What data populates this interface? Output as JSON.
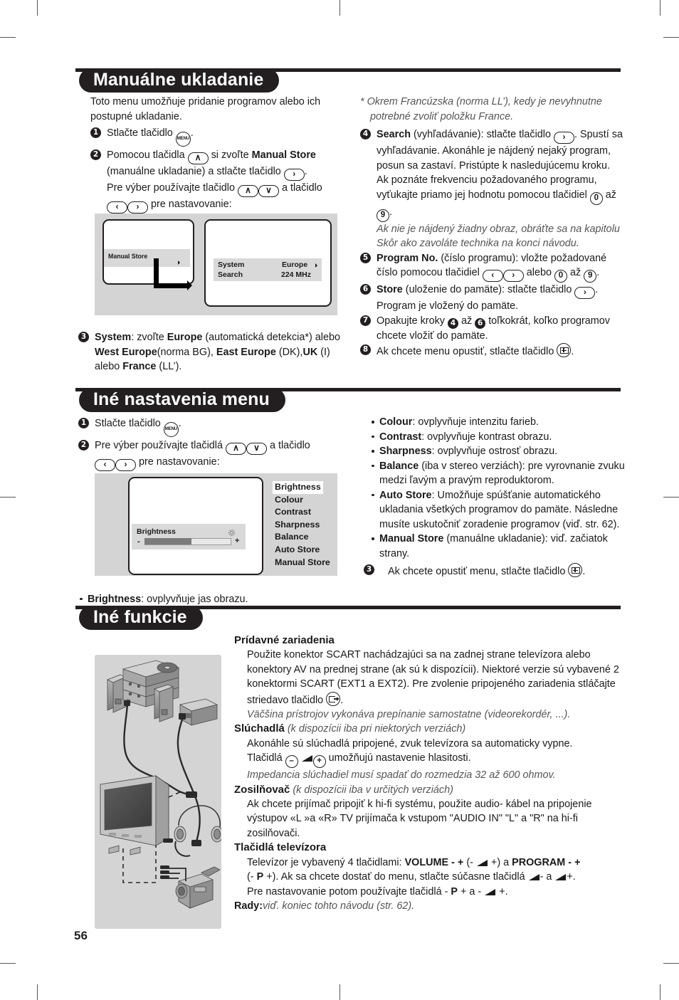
{
  "page": {
    "number": "56"
  },
  "sections": {
    "manual_store": {
      "title": "Manuálne ukladanie",
      "intro": "Toto menu umožňuje pridanie programov alebo ich postupné ukladanie.",
      "step1_pre": "Stlačte tlačidlo",
      "step1_post": ".",
      "step2_a": "Pomocou tlačidla",
      "step2_b": "si zvoľte",
      "step2_bold": "Manual Store",
      "step2_c": "(manuálne ukladanie) a stlačte tlačidlo",
      "step2_d": ".",
      "step2_e": "Pre výber používajte tlačidlo",
      "step2_f": "a tlačidlo",
      "step2_g": "pre nastavovanie:",
      "step3_bold1": "System",
      "step3_a": ": zvoľte",
      "step3_bold2": "Europe",
      "step3_b": "(automatická detekcia*) alebo",
      "step3_bold3": "West Europe",
      "step3_c": "(norma BG),",
      "step3_bold4": "East Europe",
      "step3_d": "(DK),",
      "step3_bold5": "UK",
      "step3_e": "(I) alebo",
      "step3_bold6": "France",
      "step3_f": "(LL’).",
      "footnote": "* Okrem Francúzska (norma LL’), kedy je nevyhnutne potrebné zvoliť položku France.",
      "step4_bold": "Search",
      "step4_a": "(vyhľadávanie): stlačte tlačidlo",
      "step4_b": ". Spustí sa vyhľadávanie. Akonáhle je nájdený nejaký program, posun sa zastaví. Pristúpte k nasledujúcemu kroku. Ak poznáte frekvenciu požadovaného programu, vyťukajte priamo jej hodnotu pomocou tlačidiel",
      "step4_c": "až",
      "step4_d": ".",
      "step4_note": "Ak nie je nájdený žiadny obraz, obráťte sa na kapitolu Skôr ako zavoláte technika na konci návodu.",
      "step5_bold": "Program No.",
      "step5_a": "(číslo programu): vložte požadované číslo pomocou tlačidiel",
      "step5_b": "alebo",
      "step5_c": "až",
      "step5_d": ".",
      "step6_bold": "Store",
      "step6_a": "(uloženie do pamäte): stlačte tlačidlo",
      "step6_b": ". Program je vložený do pamäte.",
      "step7_a": "Opakujte kroky",
      "step7_b": "až",
      "step7_c": "toľkokrát, koľko programov chcete vložiť do pamäte.",
      "step8_a": "Ak chcete menu opustiť, stlačte tlačidlo",
      "step8_b": ".",
      "osd": {
        "left_item": "Manual Store",
        "row1_label": "System",
        "row1_value": "Europe",
        "row2_label": "Search",
        "row2_value": "224 MHz"
      },
      "keys": {
        "menu": "MENU",
        "up": "∧",
        "down": "∨",
        "left": "‹",
        "right": "›",
        "zero": "0",
        "nine": "9",
        "num4": "4",
        "num6": "6"
      }
    },
    "other_settings": {
      "title": "Iné nastavenia menu",
      "step1_pre": "Stlačte tlačidlo",
      "step1_post": ".",
      "step2_a": "Pre výber používajte tlačidlá",
      "step2_b": "a tlačidlo",
      "step2_c": "pre nastavovanie:",
      "brightness_caption_bold": "Brightness",
      "brightness_caption_rest": ": ovplyvňuje jas obrazu.",
      "osd": {
        "slider_label": "Brightness",
        "minus": "-",
        "plus": "+",
        "menu_items": [
          "Brightness",
          "Colour",
          "Contrast",
          "Sharpness",
          "Balance",
          "Auto Store",
          "Manual Store"
        ],
        "selected_index": 0,
        "slider_percent": 54
      },
      "bullets": [
        {
          "bold": "Colour",
          "rest": ": ovplyvňuje intenzitu farieb."
        },
        {
          "bold": "Contrast",
          "rest": ": ovplyvňuje kontrast obrazu."
        },
        {
          "bold": "Sharpness",
          "rest": ": ovplyvňuje ostrosť obrazu."
        },
        {
          "bold": "Balance",
          "rest": " (iba v stereo verziách): pre vyrovnanie zvuku medzi ľavým a pravým reproduktorom."
        },
        {
          "bold": "Auto Store",
          "rest": ": Umožňuje spúšťanie automatického ukladania všetkých programov do pamäte. Následne musíte uskutočniť zoradenie programov (viď. str. 62)."
        },
        {
          "bold": "Manual Store",
          "rest": " (manuálne ukladanie): viď. začiatok strany."
        }
      ],
      "step3_a": "Ak chcete opustiť menu, stlačte tlačidlo",
      "step3_b": "."
    },
    "other_functions": {
      "title": "Iné funkcie",
      "h_pridavne": "Prídavné zariadenia",
      "pridavne_p1a": "Použite konektor SCART nachádzajúci sa na zadnej strane televízora alebo konektory AV na prednej strane (ak sú k dispozícii). Niektoré verzie sú vybavené 2 konektormi SCART (EXT1 a EXT2). Pre zvolenie pripojeného zariadenia stláčajte striedavo tlačidlo",
      "pridavne_p1b": ".",
      "pridavne_note": "Väčšina prístrojov vykonáva prepínanie samostatne (videorekordér, ...).",
      "h_sluchadla_bold": "Slúchadlá",
      "h_sluchadla_it": "(k dispozícii iba pri niektorých verziách)",
      "sluchadla_p1": "Akonáhle sú slúchadlá pripojené, zvuk televízora sa automaticky vypne.",
      "sluchadla_p2a": "Tlačidlá",
      "sluchadla_minus": "–",
      "sluchadla_plus": "+",
      "sluchadla_p2b": "umožňujú nastavenie hlasitosti.",
      "sluchadla_note": "Impedancia slúchadiel musí spadať do rozmedzia 32 až 600 ohmov.",
      "h_zosil_bold": "Zosilňovač",
      "h_zosil_it": "(k dispozícii iba v určitých verziách)",
      "zosil_p1": "Ak chcete prijímač pripojiť k hi-fi systému, použite audio-  kábel na pripojenie výstupov «L »a «R» TV prijímača k vstupom \"AUDIO IN\" \"L\" a \"R\" na hi-fi zosilňovači.",
      "h_tlacidla": "Tlačidlá televízora",
      "tl_p1a": "Televízor je vybavený 4 tlačidlami:",
      "tl_volume": "VOLUME - +",
      "tl_p1b": "(-",
      "tl_p1c": "+) a",
      "tl_program": "PROGRAM - +",
      "tl_p2a": "(-",
      "tl_p_bold": "P",
      "tl_p2b": "+). Ak sa chcete dostať do menu, stlačte súčasne tlačidlá",
      "tl_p2c": "- a",
      "tl_p2d": "+.",
      "tl_p3a": "Pre nastavovanie potom používajte tlačidlá -",
      "tl_p3b": "+ a -",
      "tl_p3c": "+.",
      "rady_bold": "Rady:",
      "rady_it": "viď. koniec tohto návodu (str. 62)."
    }
  }
}
